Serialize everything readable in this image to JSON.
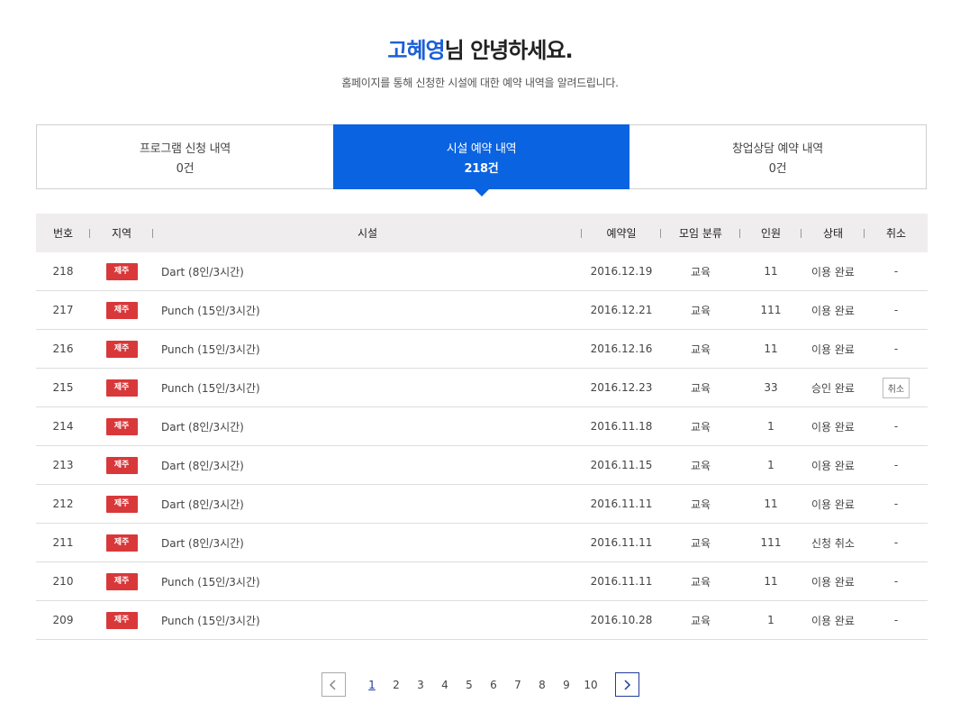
{
  "greeting": {
    "name": "고혜영",
    "suffix": "님 안녕하세요.",
    "subtitle": "홈페이지를 통해 신청한 시설에 대한 예약 내역을 알려드립니다."
  },
  "tabs": [
    {
      "label": "프로그램 신청 내역",
      "count": "0건",
      "active": false
    },
    {
      "label": "시설 예약 내역",
      "count": "218건",
      "active": true
    },
    {
      "label": "창업상담 예약 내역",
      "count": "0건",
      "active": false
    }
  ],
  "table": {
    "headers": {
      "no": "번호",
      "region": "지역",
      "facility": "시설",
      "date": "예약일",
      "type": "모임 분류",
      "people": "인원",
      "status": "상태",
      "cancel": "취소"
    },
    "rows": [
      {
        "no": "218",
        "region": "제주",
        "facility": "Dart (8인/3시간)",
        "date": "2016.12.19",
        "type": "교육",
        "people": "11",
        "status": "이용 완료",
        "cancel": "-"
      },
      {
        "no": "217",
        "region": "제주",
        "facility": "Punch (15인/3시간)",
        "date": "2016.12.21",
        "type": "교육",
        "people": "111",
        "status": "이용 완료",
        "cancel": "-"
      },
      {
        "no": "216",
        "region": "제주",
        "facility": "Punch (15인/3시간)",
        "date": "2016.12.16",
        "type": "교육",
        "people": "11",
        "status": "이용 완료",
        "cancel": "-"
      },
      {
        "no": "215",
        "region": "제주",
        "facility": "Punch (15인/3시간)",
        "date": "2016.12.23",
        "type": "교육",
        "people": "33",
        "status": "승인 완료",
        "cancel": "취소",
        "cancel_button": true
      },
      {
        "no": "214",
        "region": "제주",
        "facility": "Dart (8인/3시간)",
        "date": "2016.11.18",
        "type": "교육",
        "people": "1",
        "status": "이용 완료",
        "cancel": "-"
      },
      {
        "no": "213",
        "region": "제주",
        "facility": "Dart (8인/3시간)",
        "date": "2016.11.15",
        "type": "교육",
        "people": "1",
        "status": "이용 완료",
        "cancel": "-"
      },
      {
        "no": "212",
        "region": "제주",
        "facility": "Dart (8인/3시간)",
        "date": "2016.11.11",
        "type": "교육",
        "people": "11",
        "status": "이용 완료",
        "cancel": "-"
      },
      {
        "no": "211",
        "region": "제주",
        "facility": "Dart (8인/3시간)",
        "date": "2016.11.11",
        "type": "교육",
        "people": "111",
        "status": "신청 취소",
        "cancel": "-"
      },
      {
        "no": "210",
        "region": "제주",
        "facility": "Punch (15인/3시간)",
        "date": "2016.11.11",
        "type": "교육",
        "people": "11",
        "status": "이용 완료",
        "cancel": "-"
      },
      {
        "no": "209",
        "region": "제주",
        "facility": "Punch (15인/3시간)",
        "date": "2016.10.28",
        "type": "교육",
        "people": "1",
        "status": "이용 완료",
        "cancel": "-"
      }
    ]
  },
  "pagination": {
    "prev_icon": "chevron-left-icon",
    "next_icon": "chevron-right-icon",
    "pages": [
      "1",
      "2",
      "3",
      "4",
      "5",
      "6",
      "7",
      "8",
      "9",
      "10"
    ],
    "current": "1"
  },
  "colors": {
    "accent": "#0a63e0",
    "name": "#1c5fd6",
    "badge": "#d9383a",
    "header_bg": "#efeded",
    "pager_active": "#233c9a"
  }
}
